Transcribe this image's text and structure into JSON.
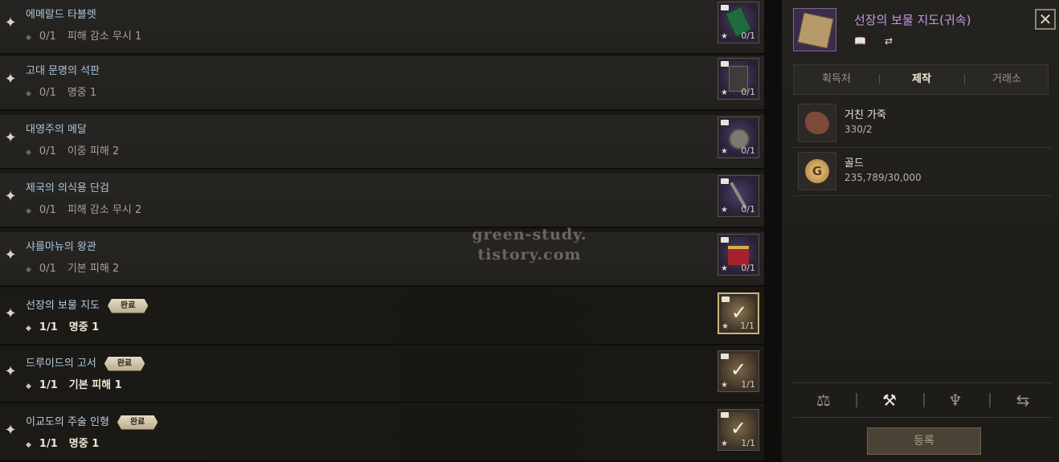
{
  "collection": {
    "items": [
      {
        "name": "에메랄드 타블렛",
        "count": "0/1",
        "effect": "피해 감소 무시 1",
        "icon_count": "0/1",
        "icon": "emerald-tablet-icon",
        "status": ""
      },
      {
        "name": "고대 문명의 석판",
        "count": "0/1",
        "effect": "명중 1",
        "icon_count": "0/1",
        "icon": "stone-tablet-icon",
        "status": ""
      },
      {
        "name": "대영주의 메달",
        "count": "0/1",
        "effect": "이중 피해 2",
        "icon_count": "0/1",
        "icon": "medal-icon",
        "status": ""
      },
      {
        "name": "제국의 의식용 단검",
        "count": "0/1",
        "effect": "피해 감소 무시 2",
        "icon_count": "0/1",
        "icon": "dagger-icon",
        "status": ""
      },
      {
        "name": "샤를마뉴의 왕관",
        "count": "0/1",
        "effect": "기본 피해 2",
        "icon_count": "0/1",
        "icon": "crown-icon",
        "status": ""
      },
      {
        "name": "선장의 보물 지도",
        "count": "1/1",
        "effect": "명중 1",
        "icon_count": "1/1",
        "icon": "check-icon",
        "status": "완료"
      },
      {
        "name": "드루이드의 고서",
        "count": "1/1",
        "effect": "기본 피해 1",
        "icon_count": "1/1",
        "icon": "check-icon",
        "status": "완료"
      },
      {
        "name": "이교도의 주술 인형",
        "count": "1/1",
        "effect": "명중 1",
        "icon_count": "1/1",
        "icon": "check-icon",
        "status": "완료"
      }
    ]
  },
  "watermark": {
    "line1": "green-study.",
    "line2": "tistory.com"
  },
  "detail": {
    "title": "선장의 보물 지도(귀속)",
    "close_glyph": "✕",
    "tabs": [
      {
        "label": "획득처"
      },
      {
        "label": "제작"
      },
      {
        "label": "거래소"
      }
    ],
    "active_tab": "제작",
    "materials": [
      {
        "name": "거친 가죽",
        "value": "330/2",
        "icon": "rough-leather-icon"
      },
      {
        "name": "골드",
        "value": "235,789/30,000",
        "icon": "gold-coin-icon"
      }
    ],
    "toolbar": [
      {
        "icon": "scale-icon",
        "glyph": "⚖"
      },
      {
        "icon": "anvil-icon",
        "glyph": "⚒"
      },
      {
        "icon": "emblem-icon",
        "glyph": "♆"
      },
      {
        "icon": "swap-icon",
        "glyph": "⇆"
      }
    ],
    "register_button": "등록"
  },
  "colors": {
    "title_purple": "#c59ae6",
    "item_title_blue": "#a9c6de",
    "badge": "#d6c9a8"
  }
}
